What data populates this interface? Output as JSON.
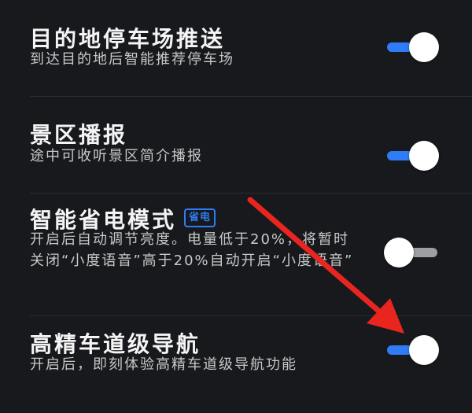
{
  "settings": [
    {
      "title": "目的地停车场推送",
      "description": "到达目的地后智能推荐停车场",
      "enabled": true
    },
    {
      "title": "景区播报",
      "description": "途中可收听景区简介播报",
      "enabled": true
    },
    {
      "title": "智能省电模式",
      "badge": "省电",
      "description": "开启后自动调节亮度。电量低于20%，将暂时关闭“小度语音”高于20%自动开启“小度语音”",
      "enabled": false
    },
    {
      "title": "高精车道级导航",
      "description": "开启后，即刻体验高精车道级导航功能",
      "enabled": true
    }
  ],
  "colors": {
    "background": "#17191d",
    "accent": "#2f7cf6",
    "arrow": "#e8251f",
    "toggle_off_track": "#9c9ea2"
  }
}
